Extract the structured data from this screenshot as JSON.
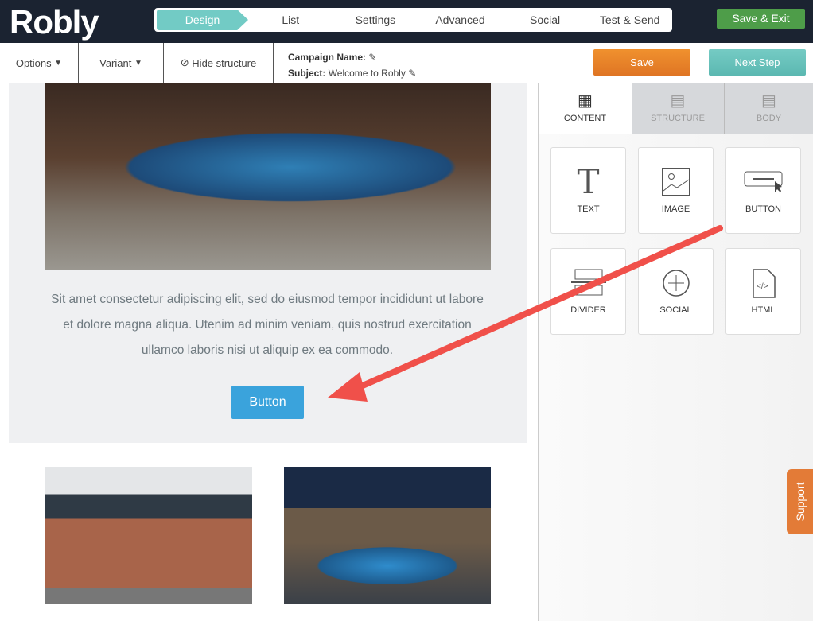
{
  "brand": "Robly",
  "steps": [
    "Design",
    "List",
    "Settings",
    "Advanced",
    "Social",
    "Test & Send"
  ],
  "active_step": "Design",
  "save_exit": "Save & Exit",
  "toolbar": {
    "options": "Options",
    "variant": "Variant",
    "hide_structure": "Hide structure",
    "campaign_label": "Campaign Name:",
    "subject_label": "Subject:",
    "subject_value": "Welcome to Robly",
    "save": "Save",
    "next": "Next Step"
  },
  "content": {
    "paragraph": "Sit amet consectetur adipiscing elit, sed do eiusmod tempor incididunt ut labore et dolore magna aliqua. Utenim ad minim veniam, quis nostrud exercitation ullamco laboris nisi ut aliquip ex ea commodo.",
    "button": "Button"
  },
  "panel": {
    "tabs": [
      "CONTENT",
      "STRUCTURE",
      "BODY"
    ],
    "tiles": [
      "TEXT",
      "IMAGE",
      "BUTTON",
      "DIVIDER",
      "SOCIAL",
      "HTML"
    ]
  },
  "support": "Support",
  "colors": {
    "accent": "#72cbc5",
    "save": "#e8822a",
    "exit": "#4e9d49",
    "annotation_arrow": "#f0504a"
  }
}
